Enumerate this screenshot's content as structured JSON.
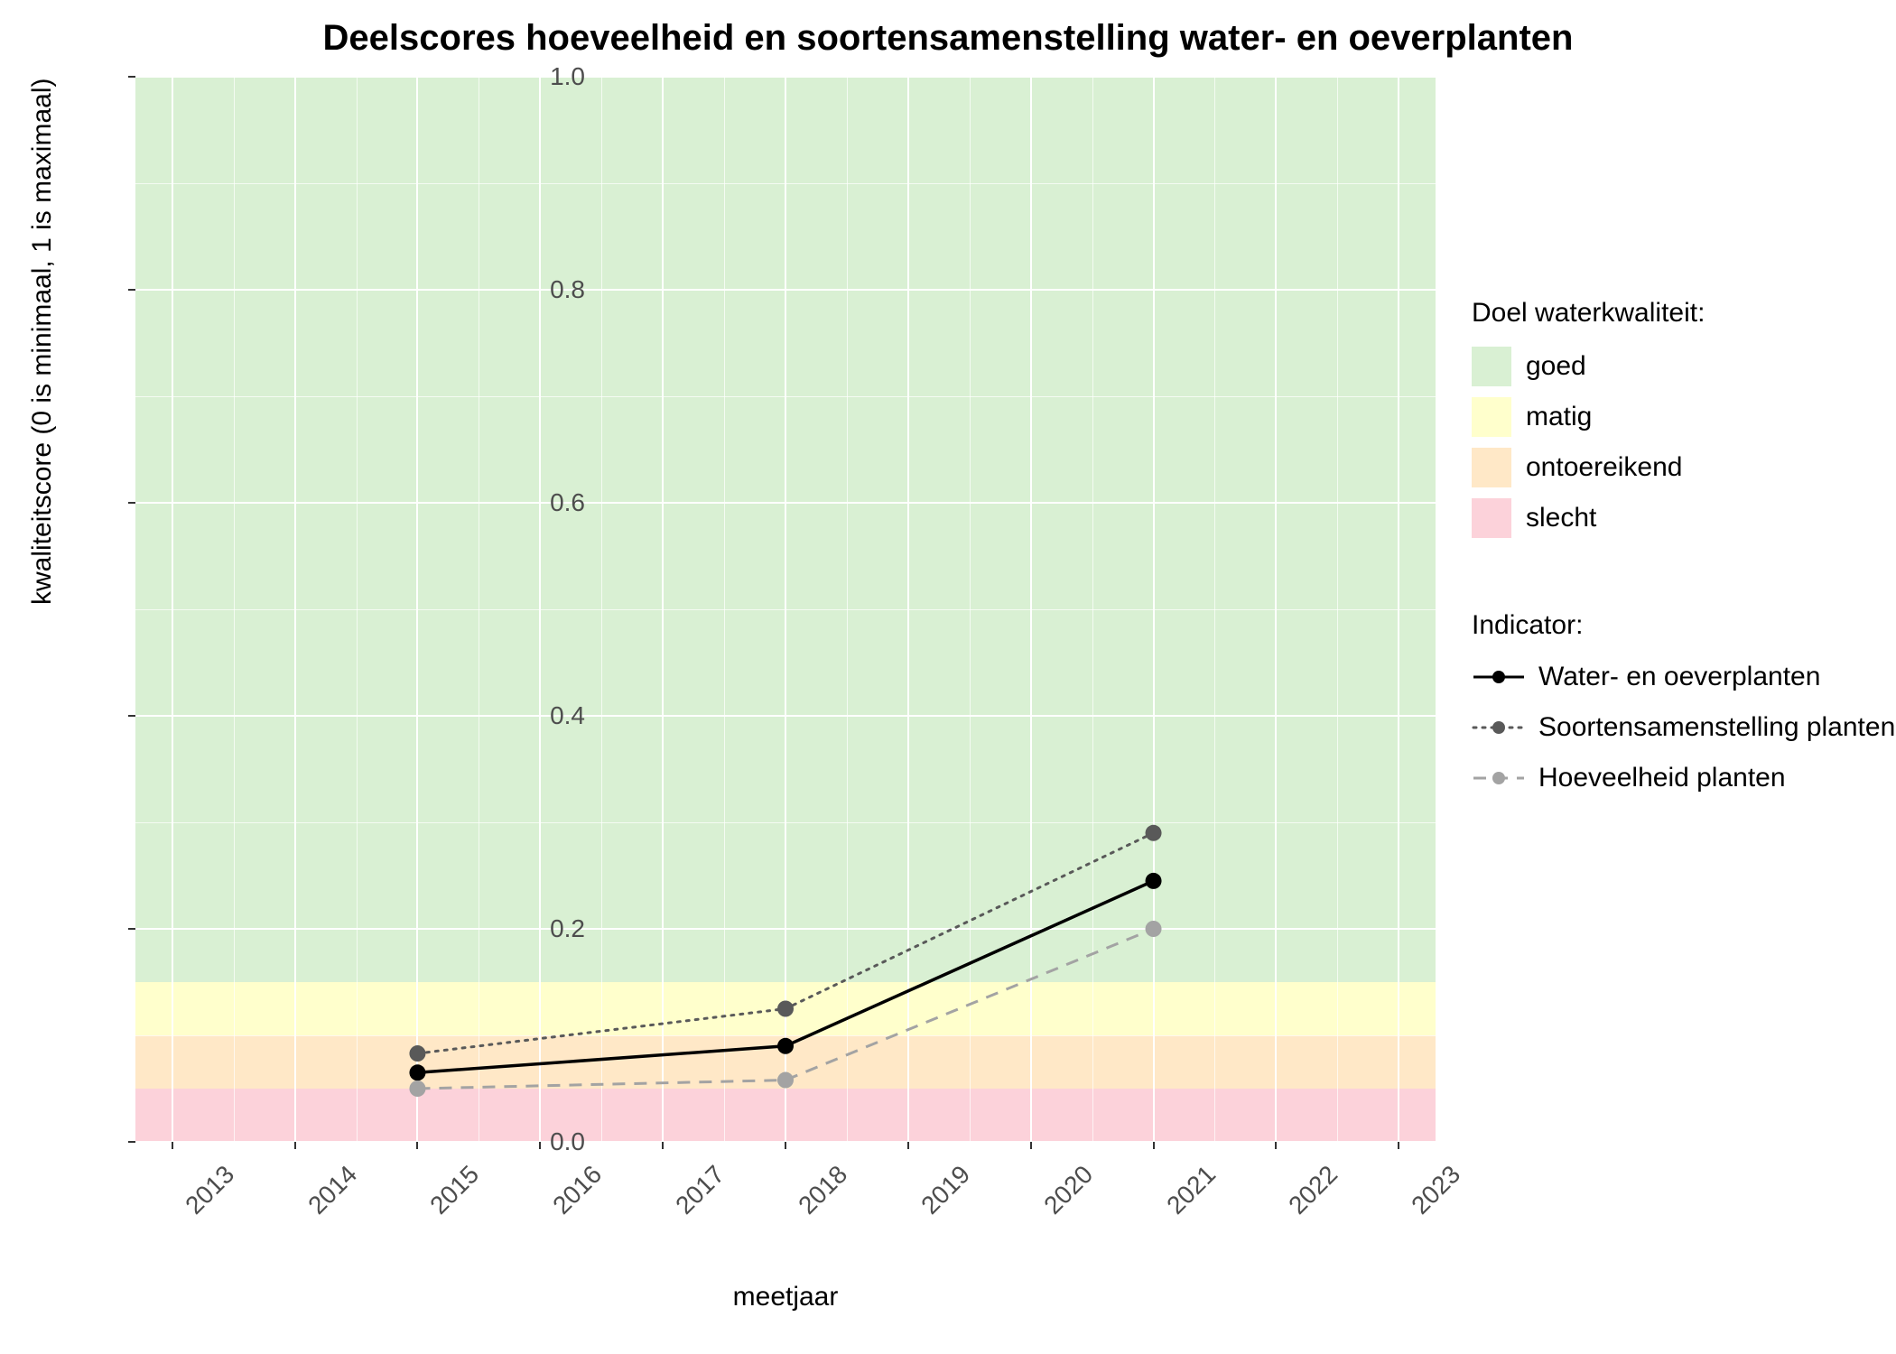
{
  "chart_data": {
    "type": "line",
    "title": "Deelscores hoeveelheid en soortensamenstelling water- en oeverplanten",
    "xlabel": "meetjaar",
    "ylabel": "kwaliteitscore (0 is minimaal, 1 is maximaal)",
    "x_ticks": [
      2013,
      2014,
      2015,
      2016,
      2017,
      2018,
      2019,
      2020,
      2021,
      2022,
      2023
    ],
    "y_ticks": [
      0.0,
      0.2,
      0.4,
      0.6,
      0.8,
      1.0
    ],
    "xlim": [
      2013,
      2023
    ],
    "ylim": [
      0.0,
      1.0
    ],
    "bands": {
      "title": "Doel waterkwaliteit:",
      "levels": [
        {
          "name": "goed",
          "color": "#d9f0d3",
          "from": 0.15,
          "to": 1.0
        },
        {
          "name": "matig",
          "color": "#ffffcc",
          "from": 0.1,
          "to": 0.15
        },
        {
          "name": "ontoereikend",
          "color": "#ffe8c7",
          "from": 0.05,
          "to": 0.1
        },
        {
          "name": "slecht",
          "color": "#fcd2da",
          "from": 0.0,
          "to": 0.05
        }
      ]
    },
    "series_legend_title": "Indicator:",
    "series": [
      {
        "name": "Water- en oeverplanten",
        "color": "#000000",
        "linestyle": "solid",
        "marker_fill": "#000000",
        "x": [
          2015,
          2018,
          2021
        ],
        "y": [
          0.065,
          0.09,
          0.245
        ]
      },
      {
        "name": "Soortensamenstelling planten",
        "color": "#595959",
        "linestyle": "dotted",
        "marker_fill": "#595959",
        "x": [
          2015,
          2018,
          2021
        ],
        "y": [
          0.083,
          0.125,
          0.29
        ]
      },
      {
        "name": "Hoeveelheid planten",
        "color": "#a3a3a3",
        "linestyle": "dashed",
        "marker_fill": "#a3a3a3",
        "x": [
          2015,
          2018,
          2021
        ],
        "y": [
          0.05,
          0.058,
          0.2
        ]
      }
    ]
  }
}
